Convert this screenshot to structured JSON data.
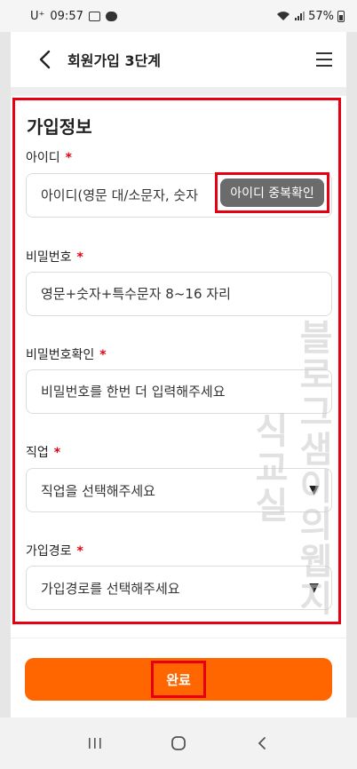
{
  "status": {
    "carrier": "U⁺",
    "time": "09:57",
    "battery": "57%"
  },
  "header": {
    "title": "회원가입 3단계"
  },
  "form": {
    "section_title": "가입정보",
    "required_mark": "*",
    "id_field": {
      "label": "아이디",
      "placeholder": "아이디(영문 대/소문자, 숫자",
      "check_button": "아이디 중복확인"
    },
    "password_field": {
      "label": "비밀번호",
      "placeholder": "영문+숫자+특수문자 8~16 자리"
    },
    "password_confirm_field": {
      "label": "비밀번호확인",
      "placeholder": "비밀번호를 한번 더 입력해주세요"
    },
    "job_field": {
      "label": "직업",
      "selected": "직업을 선택해주세요"
    },
    "route_field": {
      "label": "가입경로",
      "selected": "가입경로를 선택해주세요"
    }
  },
  "watermark": "블로그샘이의웹지식교실",
  "submit": {
    "label": "완료"
  },
  "colors": {
    "accent": "#ff6600",
    "annotation": "#e60012",
    "button_gray": "#6b6b6b"
  }
}
